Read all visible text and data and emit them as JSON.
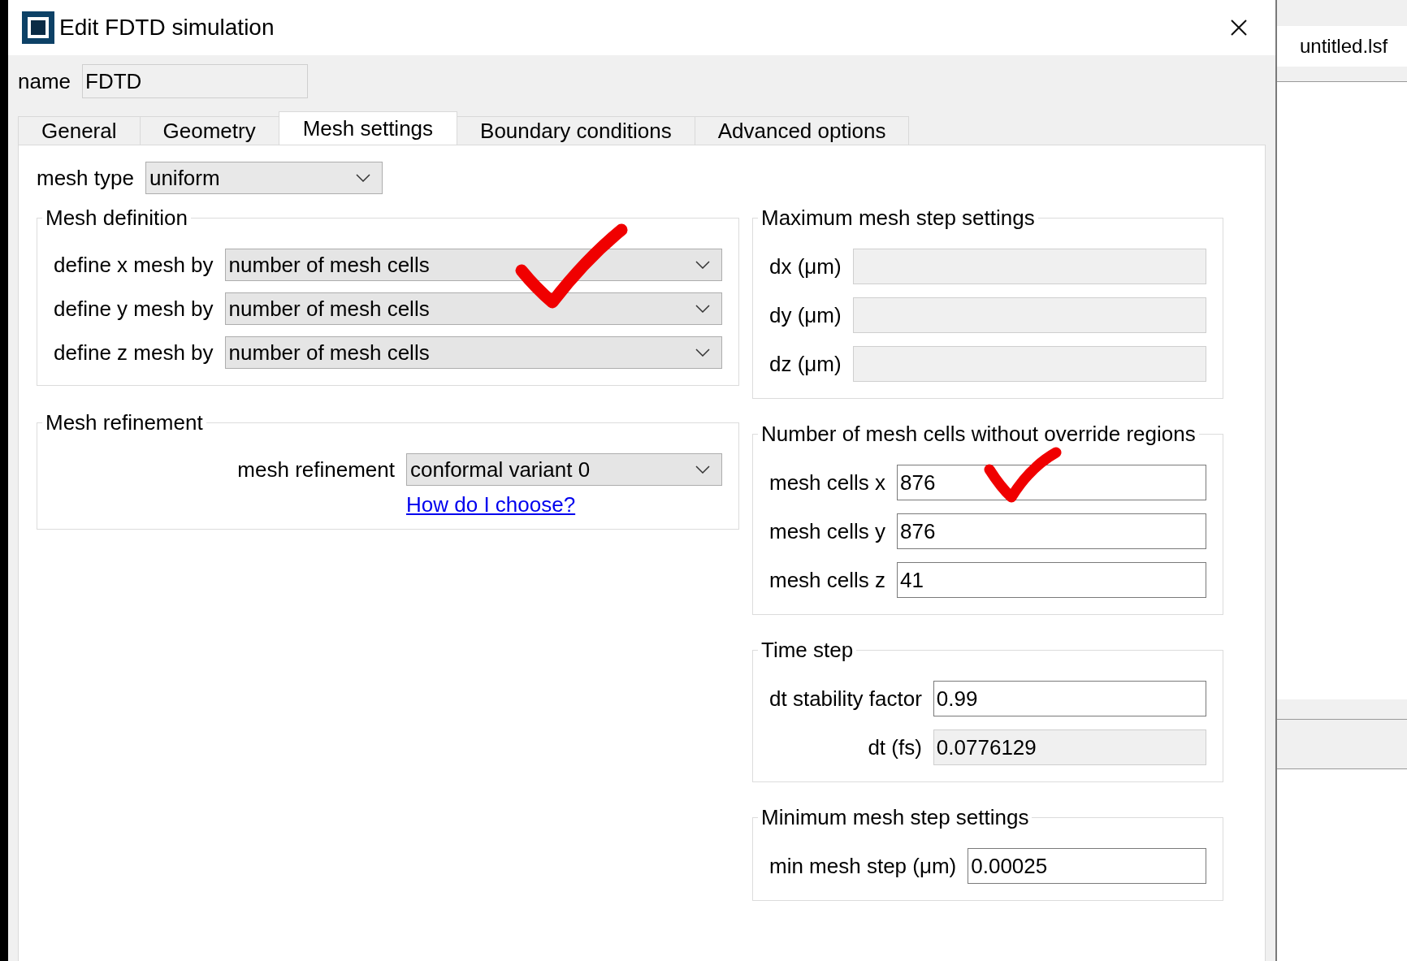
{
  "window": {
    "title": "Edit FDTD simulation"
  },
  "name_field": {
    "label": "name",
    "value": "FDTD",
    "disabled": true
  },
  "tabs": [
    {
      "label": "General",
      "selected": false
    },
    {
      "label": "Geometry",
      "selected": false
    },
    {
      "label": "Mesh settings",
      "selected": true
    },
    {
      "label": "Boundary conditions",
      "selected": false
    },
    {
      "label": "Advanced options",
      "selected": false
    }
  ],
  "mesh_type": {
    "label": "mesh type",
    "value": "uniform"
  },
  "left_groups": [
    {
      "title": "Mesh definition",
      "rows": [
        {
          "kind": "dropdown",
          "label": "define x mesh by",
          "value": "number of mesh cells"
        },
        {
          "kind": "dropdown",
          "label": "define y mesh by",
          "value": "number of mesh cells"
        },
        {
          "kind": "dropdown",
          "label": "define z mesh by",
          "value": "number of mesh cells"
        }
      ]
    },
    {
      "title": "Mesh refinement",
      "rows": [
        {
          "kind": "dropdown",
          "label": "mesh refinement",
          "value": "conformal variant 0"
        },
        {
          "kind": "link",
          "text": "How do I choose?"
        }
      ]
    }
  ],
  "right_groups": [
    {
      "title": "Maximum mesh step settings",
      "rows": [
        {
          "kind": "field",
          "label": "dx (μm)",
          "disabled": true
        },
        {
          "kind": "field",
          "label": "dy (μm)",
          "disabled": true
        },
        {
          "kind": "field",
          "label": "dz (μm)",
          "disabled": true
        }
      ]
    },
    {
      "title": "Number of mesh cells without override regions",
      "rows": [
        {
          "kind": "field",
          "label": "mesh cells x",
          "value": "876",
          "disabled": false
        },
        {
          "kind": "field",
          "label": "mesh cells y",
          "value": "876",
          "disabled": false
        },
        {
          "kind": "field",
          "label": "mesh cells z",
          "value": "41",
          "disabled": false
        }
      ]
    },
    {
      "title": "Time step",
      "rows": [
        {
          "kind": "field",
          "label": "dt stability factor",
          "value": "0.99",
          "disabled": false
        },
        {
          "kind": "field",
          "label": "dt (fs)",
          "value": "0.0776129",
          "disabled": true
        }
      ]
    },
    {
      "title": "Minimum mesh step settings",
      "rows": [
        {
          "kind": "field",
          "label": "min mesh step (μm)",
          "value": "0.00025",
          "disabled": false
        }
      ]
    }
  ],
  "side_panel": {
    "tab": "untitled.lsf"
  }
}
